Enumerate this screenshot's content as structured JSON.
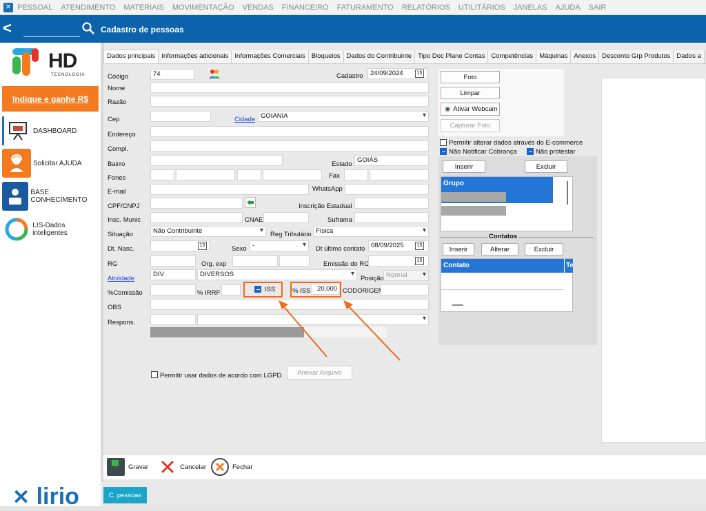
{
  "menu": {
    "items": [
      "PESSOAL",
      "ATENDIMENTO",
      "MATERIAIS",
      "MOVIMENTAÇÃO",
      "VENDAS",
      "FINANCEIRO",
      "FATURAMENTO",
      "RELATÓRIOS",
      "UTILITÁRIOS",
      "JANELAS",
      "AJUDA",
      "SAIR"
    ]
  },
  "titlebar": {
    "title": "Cadastro de pessoas"
  },
  "sidebar": {
    "logo_text": "HD",
    "logo_sub": "TECNOLOGIA",
    "promo": "Indique e ganhe R$",
    "items": [
      {
        "label": "DASHBOARD",
        "icon": "presentation-board-icon"
      },
      {
        "label": "Solicitar AJUDA",
        "icon": "support-agent-icon"
      },
      {
        "label": "BASE CONHECIMENTO",
        "icon": "knowledge-base-icon"
      },
      {
        "label": "LIS-Dados inteligentes",
        "icon": "ring-chart-icon"
      }
    ],
    "brand": "lirio"
  },
  "tabs": [
    "Dados principais",
    "Informações adicionais",
    "Informações Comerciais",
    "Bloqueios",
    "Dados do Contribuinte",
    "Tipo Doc Plano Contas",
    "Competências",
    "Máquinas",
    "Anexos",
    "Desconto Grp Produtos",
    "Dados a"
  ],
  "form": {
    "codigo_label": "Código",
    "codigo": "74",
    "cadastro_label": "Cadastro",
    "cadastro": "24/09/2024",
    "nome_label": "Nome",
    "razao_label": "Razão",
    "cep_label": "Cep",
    "cidade_label": "Cidade",
    "cidade": "GOIANIA",
    "endereco_label": "Endereço",
    "compl_label": "Compl.",
    "bairro_label": "Bairro",
    "estado_label": "Estado",
    "estado": "GOIÁS",
    "fones_label": "Fones",
    "fax_label": "Fax",
    "email_label": "E-mail",
    "whatsapp_label": "WhatsApp",
    "cpf_label": "CPF/CNPJ",
    "ie_label": "Inscrição Estadual",
    "im_label": "Insc. Munic",
    "cnae_label": "CNAE",
    "suframa_label": "Suframa",
    "situacao_label": "Situação",
    "situacao": "Não Contribuinte",
    "regtrib_label": "Reg Tributário",
    "regtrib": "Física",
    "dtnasc_label": "Dt. Nasc.",
    "sexo_label": "Sexo",
    "sexo": "-",
    "ultcontato_label": "Dt último contato",
    "ultcontato": "08/09/2025",
    "rg_label": "RG",
    "orgexp_label": "Org. exp",
    "emissaorg_label": "Emissão do RG",
    "atividade_label": "Atividade",
    "atividade_code": "DIV",
    "atividade": "DIVERSOS",
    "posicao_label": "Posição",
    "posicao": "Normal",
    "comissao_label": "%Comissão",
    "irrf_label": "% IRRF",
    "iss_label": "ISS",
    "pct_iss_label": "% ISS",
    "pct_iss": "20,000",
    "codorigem_label": "CODORIGEM",
    "obs_label": "OBS",
    "respons_label": "Respons.",
    "lgpd_label": "Permitir usar dados de acordo com LGPD",
    "anexar_label": "Anexar Arquivo"
  },
  "photo": {
    "foto": "Foto",
    "limpar": "Limpar",
    "webcam": "Ativar Webcam",
    "capturar": "Capturar Foto"
  },
  "options": {
    "ecommerce": "Permitir alterar dados através do E-commerce",
    "nao_notificar": "Não Notificar Cobrança",
    "nao_protestar": "Não protestar"
  },
  "grupo": {
    "inserir": "Inserir",
    "excluir": "Excluir",
    "header": "Grupo"
  },
  "contatos": {
    "title": "Contatos",
    "inserir": "Inserir",
    "alterar": "Alterar",
    "excluir": "Excluir",
    "col1": "Contato",
    "col2": "Te"
  },
  "bottom": {
    "gravar": "Gravar",
    "cancelar": "Cancelar",
    "fechar": "Fechar"
  },
  "taskbar": {
    "tab": "C. pessoas"
  },
  "colors": {
    "primary": "#0c63ac",
    "accent": "#f47a20",
    "highlight": "#ef6a1d",
    "taskbar_tab": "#1aa5c9"
  }
}
